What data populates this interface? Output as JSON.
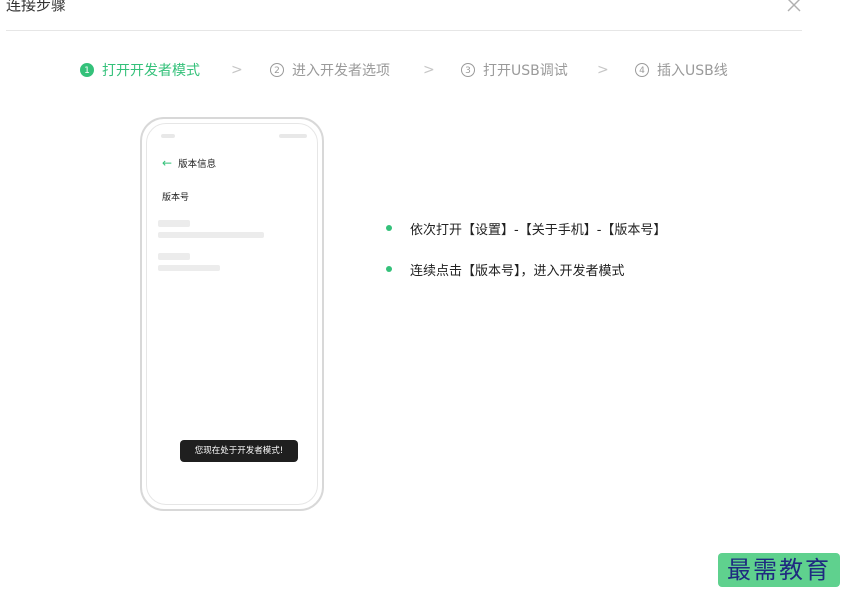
{
  "dialog": {
    "title": "连接步骤",
    "close_icon": "close-icon"
  },
  "steps": [
    {
      "number": "1",
      "label": "打开开发者模式",
      "active": true
    },
    {
      "number": "2",
      "label": "进入开发者选项",
      "active": false
    },
    {
      "number": "3",
      "label": "打开USB调试",
      "active": false
    },
    {
      "number": "4",
      "label": "插入USB线",
      "active": false
    }
  ],
  "step_separator_icon": "chevron-right-icon",
  "phone": {
    "back_icon": "arrow-left-icon",
    "header_title": "版本信息",
    "version_label": "版本号",
    "toast": "您现在处于开发者模式!"
  },
  "instructions": [
    "依次打开【设置】-【关于手机】-【版本号】",
    "连续点击【版本号】，进入开发者模式"
  ],
  "watermark": "最需教育",
  "colors": {
    "accent": "#34c17a",
    "inactive": "#9a9a9a",
    "separator": "#c6c6c6",
    "toast_bg": "#1f1f1f"
  }
}
